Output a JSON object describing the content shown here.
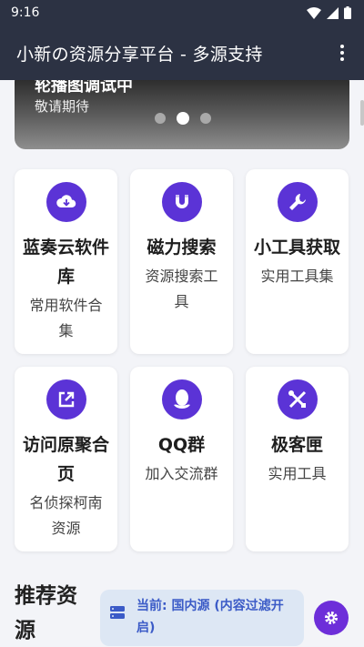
{
  "status_bar": {
    "time": "9:16"
  },
  "app_bar": {
    "title": "小新の资源分享平台 - 多源支持"
  },
  "carousel": {
    "title": "轮播图调试中",
    "subtitle": "敬请期待",
    "active_index": 1,
    "total": 3
  },
  "cards": [
    {
      "title": "蓝奏云软件库",
      "desc": "常用软件合集",
      "icon": "cloud-download-icon"
    },
    {
      "title": "磁力搜索",
      "desc": "资源搜索工具",
      "icon": "magnet-icon"
    },
    {
      "title": "小工具获取",
      "desc": "实用工具集",
      "icon": "wrench-icon"
    },
    {
      "title": "访问原聚合页",
      "desc": "名侦探柯南资源",
      "icon": "external-link-icon"
    },
    {
      "title": "QQ群",
      "desc": "加入交流群",
      "icon": "qq-icon"
    },
    {
      "title": "极客匣",
      "desc": "实用工具",
      "icon": "tools-icon"
    }
  ],
  "recommend": {
    "title": "推荐资源",
    "source_status": "当前: 国内源 (内容过滤开启)"
  },
  "colors": {
    "app_bar": "#2c3243",
    "accent": "#5b33d6",
    "fab": "#6d2ed9",
    "pill": "#dde7f4"
  }
}
